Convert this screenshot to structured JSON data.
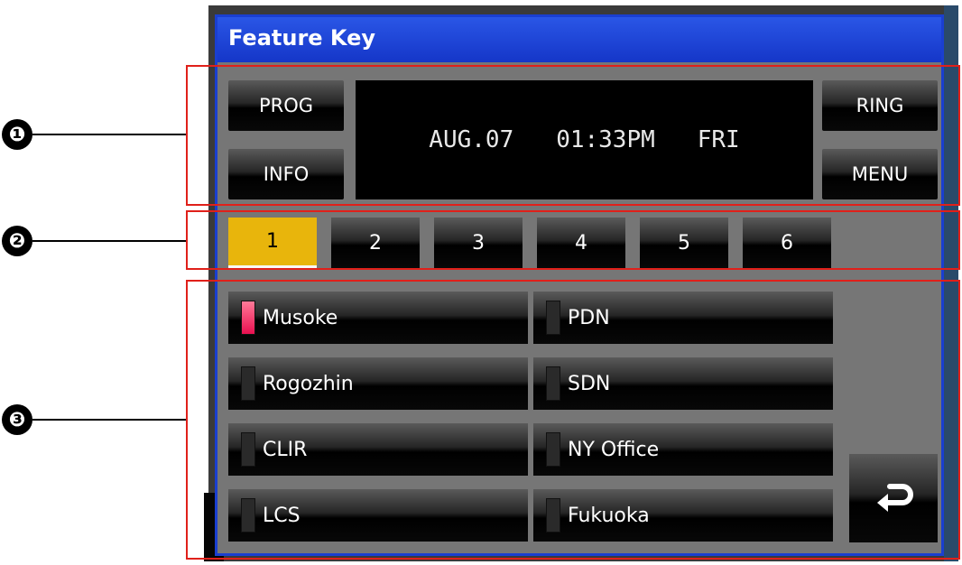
{
  "window": {
    "title": "Feature Key"
  },
  "callouts": [
    "❶",
    "❷",
    "❸"
  ],
  "display": {
    "date": "AUG.07",
    "time": "01:33PM",
    "day": "FRI"
  },
  "left_keys": {
    "prog": "PROG",
    "info": "INFO"
  },
  "right_keys": {
    "ring": "RING",
    "menu": "MENU"
  },
  "tabs": [
    {
      "label": "1",
      "active": true
    },
    {
      "label": "2",
      "active": false
    },
    {
      "label": "3",
      "active": false
    },
    {
      "label": "4",
      "active": false
    },
    {
      "label": "5",
      "active": false
    },
    {
      "label": "6",
      "active": false
    }
  ],
  "feature_keys": [
    {
      "label": "Musoke",
      "led": "on"
    },
    {
      "label": "PDN",
      "led": "off"
    },
    {
      "label": "Rogozhin",
      "led": "off"
    },
    {
      "label": "SDN",
      "led": "off"
    },
    {
      "label": "CLIR",
      "led": "off"
    },
    {
      "label": "NY Office",
      "led": "off"
    },
    {
      "label": "LCS",
      "led": "off"
    },
    {
      "label": "Fukuoka",
      "led": "off"
    }
  ],
  "back_button": {
    "icon": "return-arrow-icon"
  },
  "colors": {
    "title_bar": "#1f48dc",
    "active_tab": "#e8b50c",
    "led_on": "#e81050",
    "callout_box": "#e0201a"
  }
}
